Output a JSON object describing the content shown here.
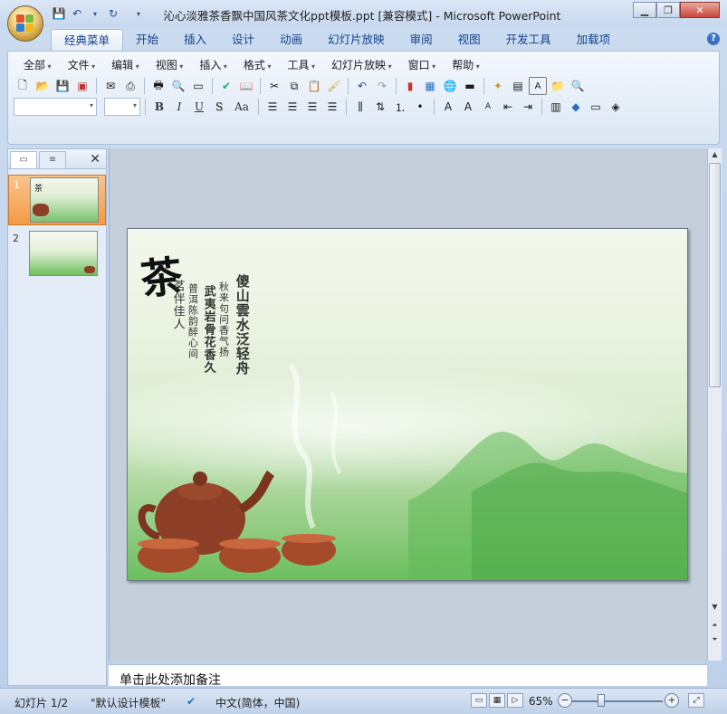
{
  "window": {
    "title": "沁心淡雅茶香飘中国风茶文化ppt模板.ppt [兼容模式] - Microsoft PowerPoint",
    "controls": [
      "minimize",
      "restore",
      "close"
    ]
  },
  "quick_access": [
    "save-icon",
    "undo-icon",
    "redo-icon",
    "customize-icon"
  ],
  "ribbon_tabs": [
    {
      "label": "经典菜单",
      "active": true
    },
    {
      "label": "开始"
    },
    {
      "label": "插入"
    },
    {
      "label": "设计"
    },
    {
      "label": "动画"
    },
    {
      "label": "幻灯片放映"
    },
    {
      "label": "审阅"
    },
    {
      "label": "视图"
    },
    {
      "label": "开发工具"
    },
    {
      "label": "加载项"
    }
  ],
  "classic_menu": [
    "全部",
    "文件",
    "编辑",
    "视图",
    "插入",
    "格式",
    "工具",
    "幻灯片放映",
    "窗口",
    "帮助"
  ],
  "format_buttons": {
    "bold": "B",
    "italic": "I",
    "underline": "U",
    "shadow": "S",
    "case": "Aa"
  },
  "slides_panel": {
    "tabs": [
      "slides-tab",
      "outline-tab"
    ],
    "slides": [
      {
        "number": "1",
        "selected": true
      },
      {
        "number": "2",
        "selected": false
      }
    ]
  },
  "slide": {
    "title_char": "茶",
    "poem_lines": [
      "傻山雲水泛轻舟",
      "秋来句问香气扬",
      "武夷岩骨花香久",
      "普洱陈韵醉心间",
      "茗伴佳人"
    ]
  },
  "notes": {
    "placeholder": "单击此处添加备注"
  },
  "status_bar": {
    "slide_counter": "幻灯片 1/2",
    "theme": "\"默认设计模板\"",
    "language": "中文(简体，中国)",
    "zoom": "65%"
  },
  "colors": {
    "accent": "#15428b",
    "ribbon": "#dbe6f4",
    "selected_thumb": "#f39a44"
  }
}
